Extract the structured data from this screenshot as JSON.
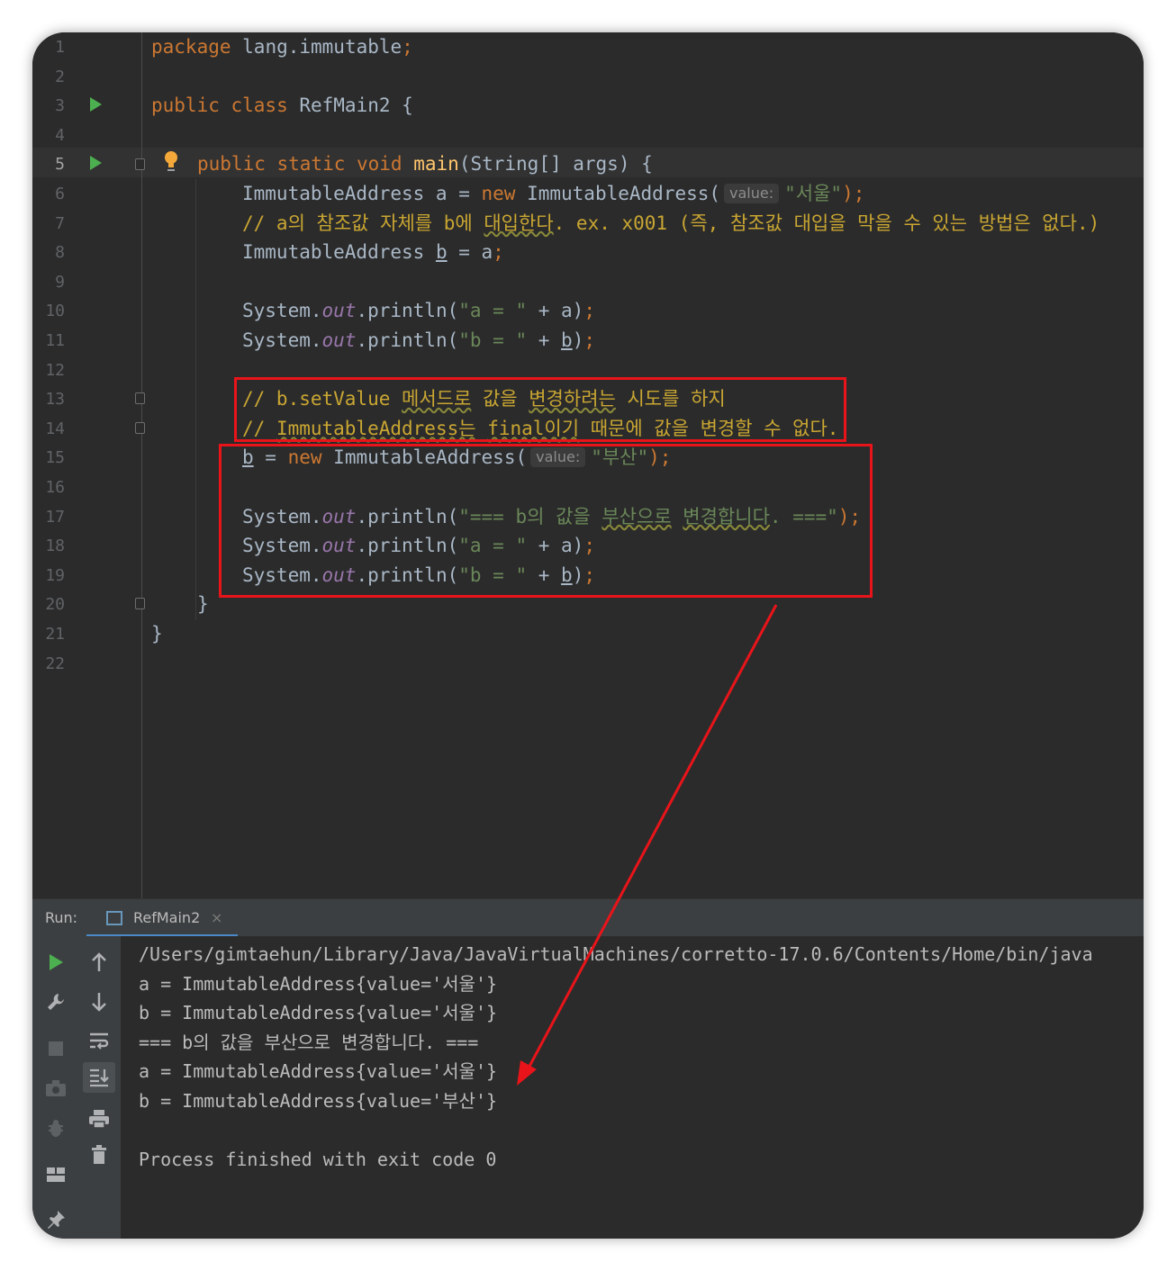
{
  "editor": {
    "line_numbers": [
      "1",
      "2",
      "3",
      "4",
      "5",
      "6",
      "7",
      "8",
      "9",
      "10",
      "11",
      "12",
      "13",
      "14",
      "15",
      "16",
      "17",
      "18",
      "19",
      "20",
      "21",
      "22"
    ],
    "current_line": "5",
    "lines": {
      "l1_kw": "package",
      "l1_rest": " lang.immutable",
      "l1_semi": ";",
      "l3_kw": "public class",
      "l3_rest": " RefMain2 {",
      "l5_kw": "public static void",
      "l5_fn": "main",
      "l5_rest": "(String[] args) {",
      "l6_a": "ImmutableAddress a = ",
      "l6_kw": "new",
      "l6_b": " ImmutableAddress(",
      "l6_hint": "value:",
      "l6_str": "\"서울\"",
      "l6_end": ");",
      "l7_a": "// a의 참조값 자체를 b에 ",
      "l7_wavy": "대입한다",
      "l7_b": ". ex. x001 (즉, 참조값 대입을 막을 수 있는 방법은 없다.)",
      "l8_a": "ImmutableAddress ",
      "l8_b": "b",
      "l8_c": " = a",
      "l8_semi": ";",
      "l10_a": "System.",
      "l10_out": "out",
      "l10_b": ".println(",
      "l10_str": "\"a = \"",
      "l10_c": " + a)",
      "l10_semi": ";",
      "l11_a": "System.",
      "l11_out": "out",
      "l11_b": ".println(",
      "l11_str": "\"b = \"",
      "l11_c": " + ",
      "l11_var": "b",
      "l11_d": ")",
      "l11_semi": ";",
      "l13_a": "// b.setValue ",
      "l13_w1": "메서드로",
      "l13_b": " 값을 ",
      "l13_w2": "변경하려는",
      "l13_c": " 시도를 하지",
      "l14_a": "// ",
      "l14_w1": "ImmutableAddress는",
      "l14_b": " ",
      "l14_w2": "final이기",
      "l14_c": " 때문에 값을 변경할 수 없다.",
      "l15_var": "b",
      "l15_a": " = ",
      "l15_kw": "new",
      "l15_b": " ImmutableAddress(",
      "l15_hint": "value:",
      "l15_str": "\"부산\"",
      "l15_end": ");",
      "l17_a": "System.",
      "l17_out": "out",
      "l17_b": ".println(",
      "l17_s1": "\"=== b의 값을 ",
      "l17_w1": "부산으로",
      "l17_s2": " ",
      "l17_w2": "변경합니다",
      "l17_s3": ". ===\"",
      "l17_end": ");",
      "l18_a": "System.",
      "l18_out": "out",
      "l18_b": ".println(",
      "l18_str": "\"a = \"",
      "l18_c": " + a)",
      "l18_semi": ";",
      "l19_a": "System.",
      "l19_out": "out",
      "l19_b": ".println(",
      "l19_str": "\"b = \"",
      "l19_c": " + ",
      "l19_var": "b",
      "l19_d": ")",
      "l19_semi": ";",
      "l20": "}",
      "l21": "}"
    }
  },
  "run_panel": {
    "label": "Run:",
    "tab_name": "RefMain2",
    "tab_close": "×",
    "output": [
      "/Users/gimtaehun/Library/Java/JavaVirtualMachines/corretto-17.0.6/Contents/Home/bin/java",
      "a = ImmutableAddress{value='서울'}",
      "b = ImmutableAddress{value='서울'}",
      "=== b의 값을 부산으로 변경합니다. ===",
      "a = ImmutableAddress{value='서울'}",
      "b = ImmutableAddress{value='부산'}",
      "",
      "Process finished with exit code 0"
    ]
  },
  "colors": {
    "annotation": "#e8141a",
    "editor_bg": "#2b2b2b",
    "panel_bg": "#3c3f41",
    "keyword": "#cc7832",
    "string": "#6a8759",
    "comment": "#c9a632"
  },
  "icons": [
    "run-icon",
    "wrench-icon",
    "stop-icon",
    "camera-icon",
    "bug-icon",
    "layout-icon",
    "pin-icon",
    "arrow-up-icon",
    "arrow-down-icon",
    "soft-wrap-icon",
    "scroll-to-end-icon",
    "print-icon",
    "trash-icon",
    "lightbulb-icon"
  ]
}
